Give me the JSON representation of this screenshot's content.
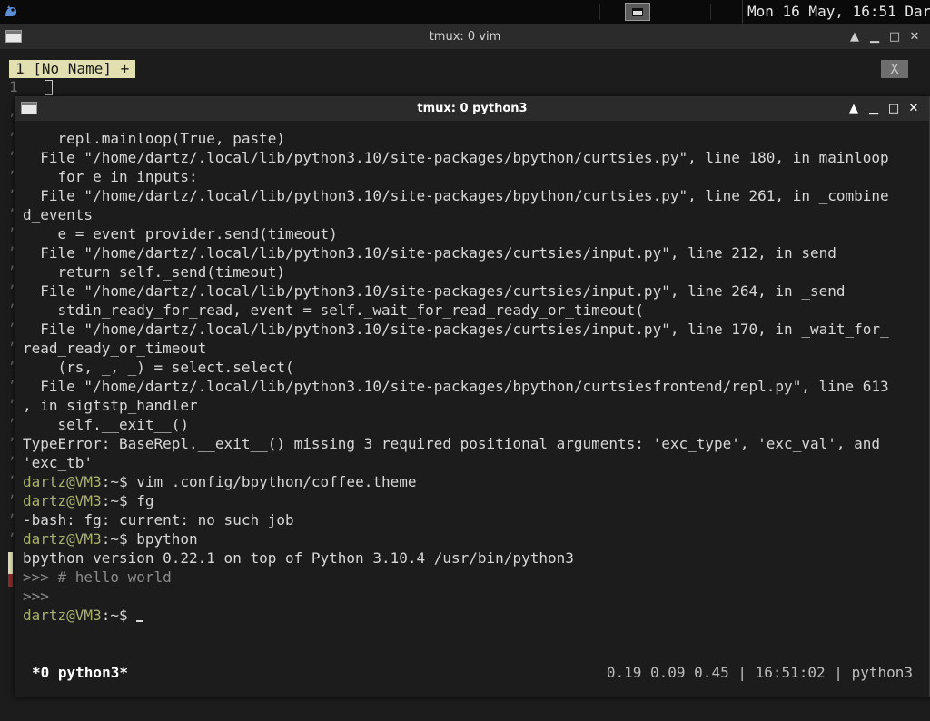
{
  "panel": {
    "clock": "Mon 16 May, 16:51",
    "user": "Dartz"
  },
  "vim_window": {
    "title": "tmux: 0 vim",
    "tab_label": "1 [No Name] +",
    "close_tab": "X",
    "line_number": "1"
  },
  "python_window": {
    "title": "tmux: 0 python3",
    "terminal": {
      "lines": [
        {
          "type": "text",
          "text": "    repl.mainloop(True, paste)"
        },
        {
          "type": "text",
          "text": "  File \"/home/dartz/.local/lib/python3.10/site-packages/bpython/curtsies.py\", line 180, in mainloop"
        },
        {
          "type": "text",
          "text": "    for e in inputs:"
        },
        {
          "type": "text",
          "text": "  File \"/home/dartz/.local/lib/python3.10/site-packages/bpython/curtsies.py\", line 261, in _combine"
        },
        {
          "type": "text",
          "text": "d_events"
        },
        {
          "type": "text",
          "text": "    e = event_provider.send(timeout)"
        },
        {
          "type": "text",
          "text": "  File \"/home/dartz/.local/lib/python3.10/site-packages/curtsies/input.py\", line 212, in send"
        },
        {
          "type": "text",
          "text": "    return self._send(timeout)"
        },
        {
          "type": "text",
          "text": "  File \"/home/dartz/.local/lib/python3.10/site-packages/curtsies/input.py\", line 264, in _send"
        },
        {
          "type": "text",
          "text": "    stdin_ready_for_read, event = self._wait_for_read_ready_or_timeout("
        },
        {
          "type": "text",
          "text": "  File \"/home/dartz/.local/lib/python3.10/site-packages/curtsies/input.py\", line 170, in _wait_for_"
        },
        {
          "type": "text",
          "text": "read_ready_or_timeout"
        },
        {
          "type": "text",
          "text": "    (rs, _, _) = select.select("
        },
        {
          "type": "text",
          "text": "  File \"/home/dartz/.local/lib/python3.10/site-packages/bpython/curtsiesfrontend/repl.py\", line 613"
        },
        {
          "type": "text",
          "text": ", in sigtstp_handler"
        },
        {
          "type": "text",
          "text": "    self.__exit__()"
        },
        {
          "type": "text",
          "text": "TypeError: BaseRepl.__exit__() missing 3 required positional arguments: 'exc_type', 'exc_val', and"
        },
        {
          "type": "text",
          "text": "'exc_tb'"
        },
        {
          "type": "prompt",
          "user": "dartz@VM3",
          "path": ":~$",
          "cmd": " vim .config/bpython/coffee.theme"
        },
        {
          "type": "prompt",
          "user": "dartz@VM3",
          "path": ":~$",
          "cmd": " fg"
        },
        {
          "type": "text",
          "text": "-bash: fg: current: no such job"
        },
        {
          "type": "prompt",
          "user": "dartz@VM3",
          "path": ":~$",
          "cmd": " bpython"
        },
        {
          "type": "text",
          "text": "bpython version 0.22.1 on top of Python 3.10.4 /usr/bin/python3"
        },
        {
          "type": "dim",
          "text": ">>> # hello world"
        },
        {
          "type": "dim",
          "text": ">>>"
        },
        {
          "type": "prompt_cursor",
          "user": "dartz@VM3",
          "path": ":~$",
          "cmd": " "
        }
      ]
    },
    "status": {
      "left": "*0 python3*",
      "right": "0.19 0.09 0.45 | 16:51:02 | python3"
    }
  }
}
